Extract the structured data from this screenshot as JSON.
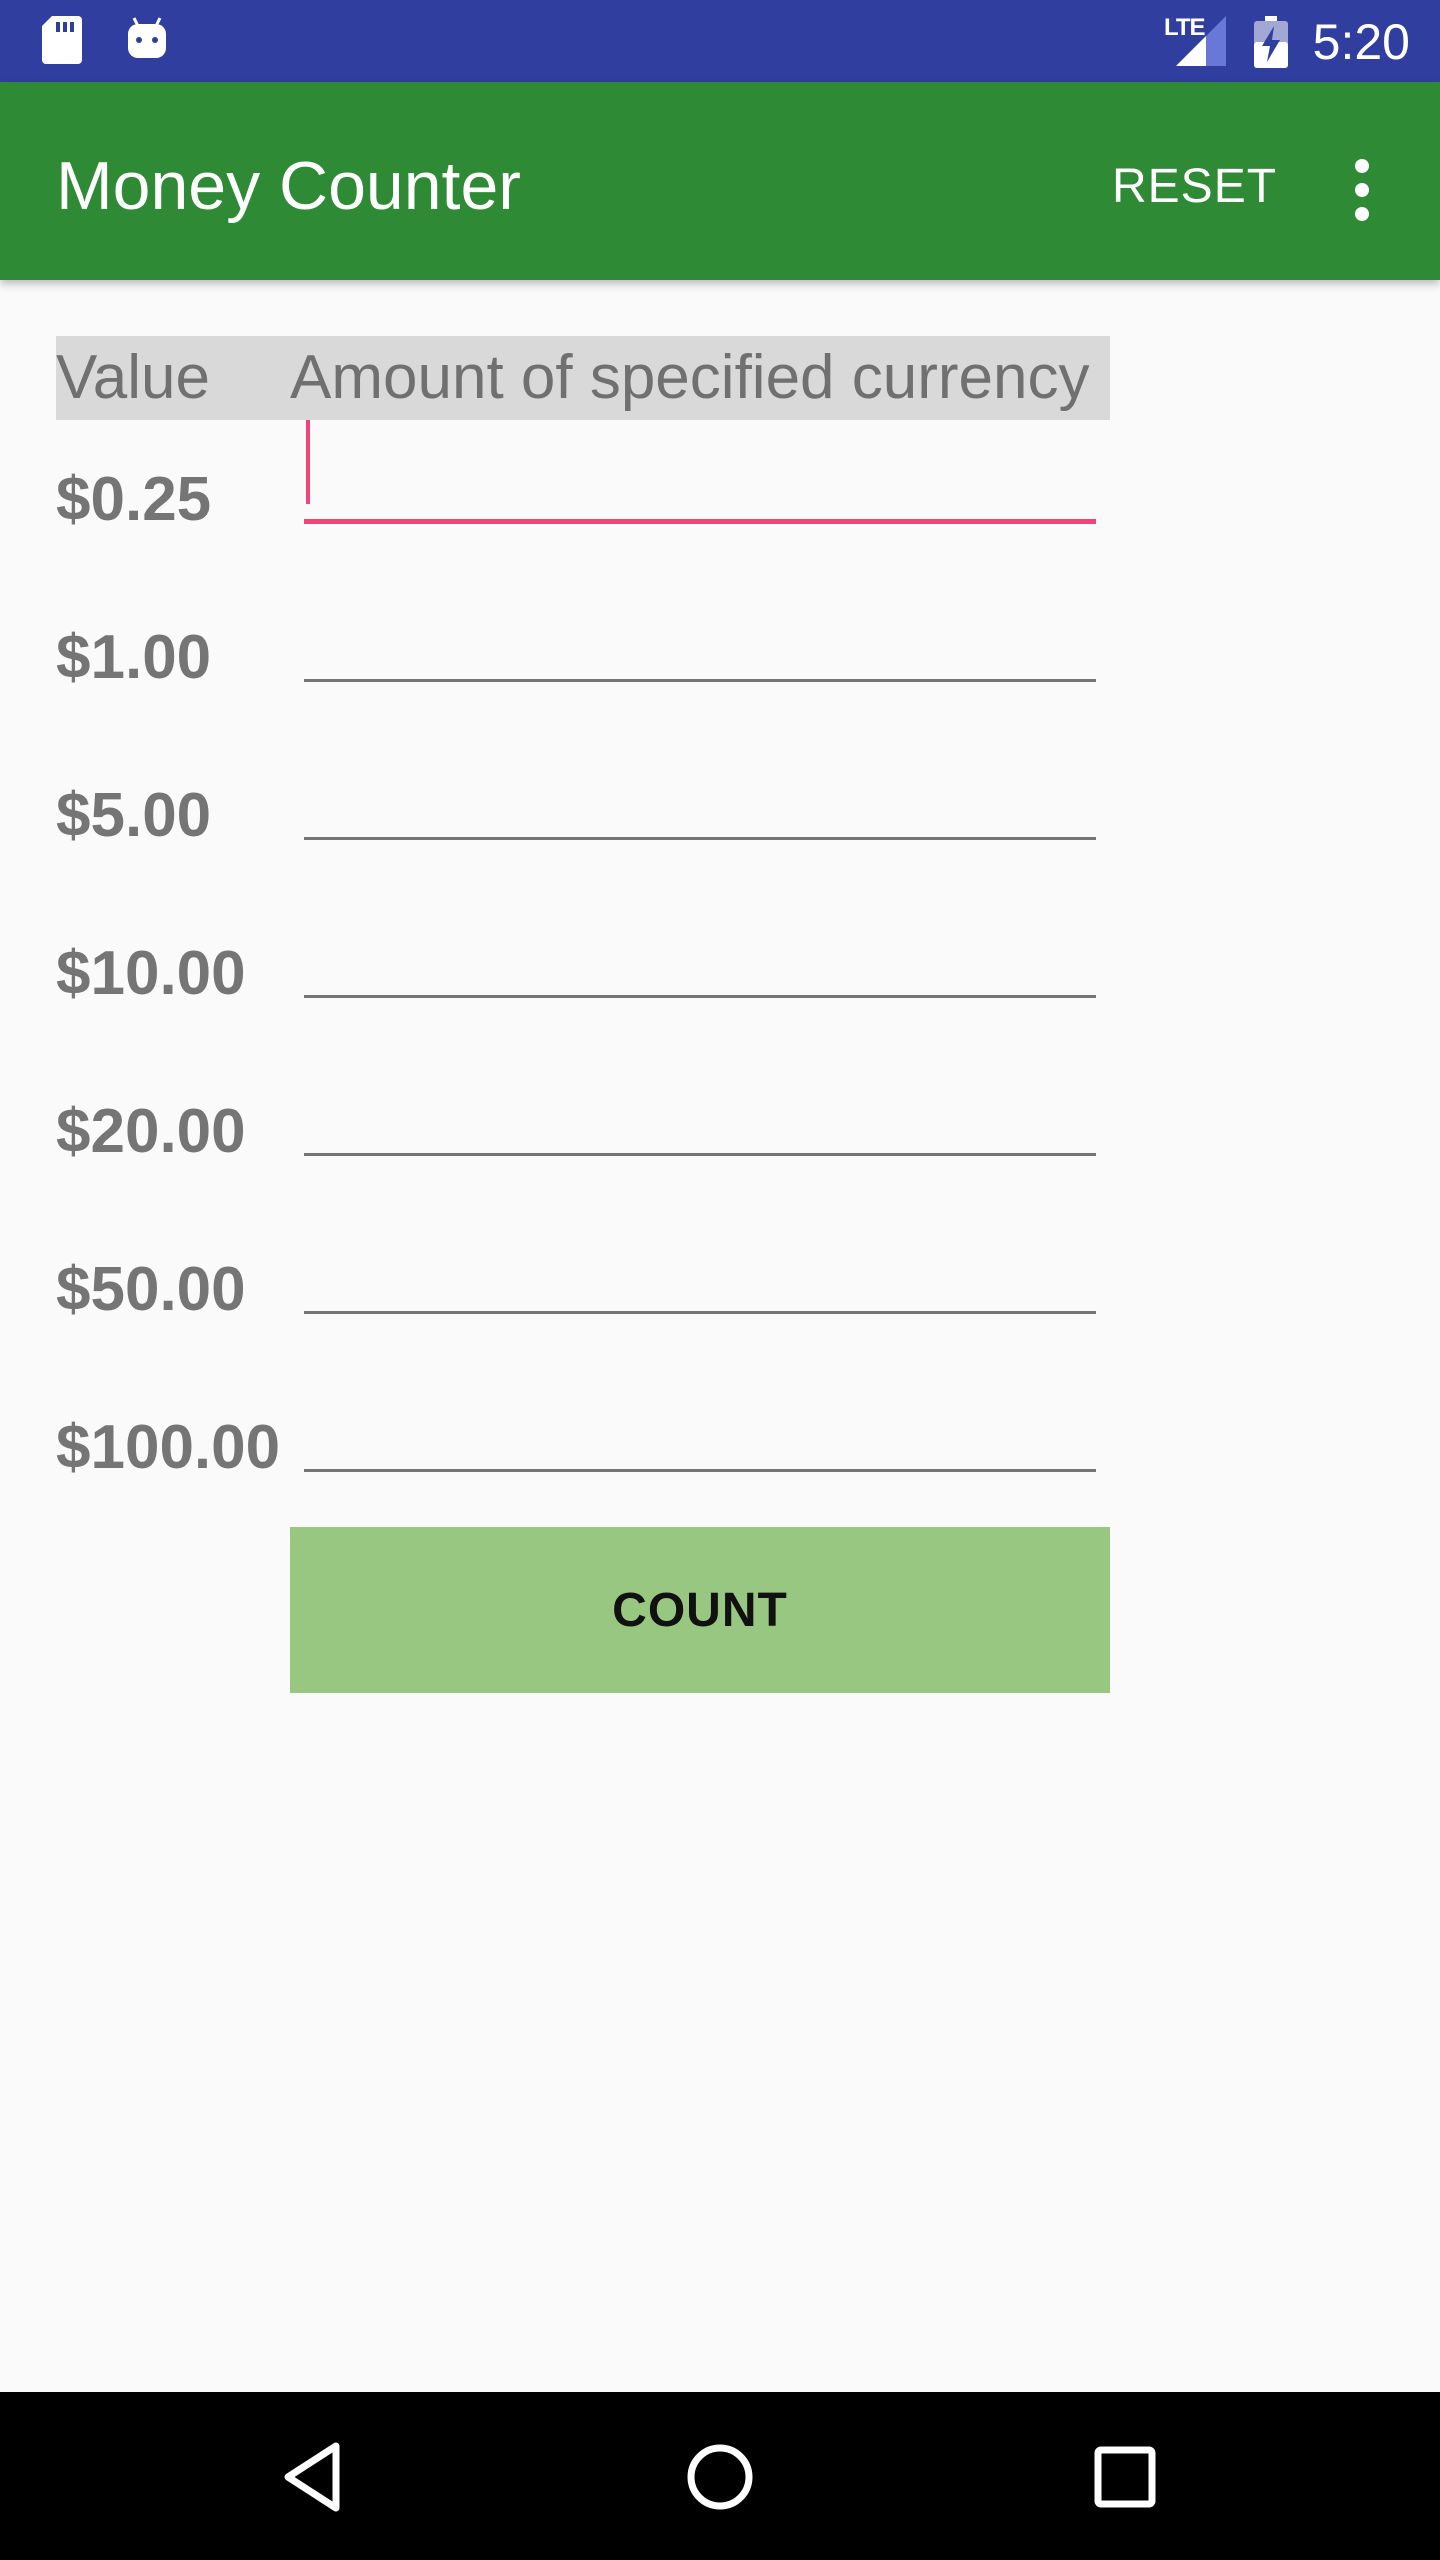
{
  "status_bar": {
    "time": "5:20",
    "network": "LTE",
    "icons": [
      "sd-card-icon",
      "android-icon",
      "signal-icon",
      "battery-charging-icon"
    ]
  },
  "app_bar": {
    "title": "Money Counter",
    "reset_label": "RESET",
    "overflow_icon": "more-vert-icon"
  },
  "table": {
    "header_value": "Value",
    "header_amount": "Amount of specified currency",
    "rows": [
      {
        "label": "$0.25",
        "value": ""
      },
      {
        "label": "$1.00",
        "value": ""
      },
      {
        "label": "$5.00",
        "value": ""
      },
      {
        "label": "$10.00",
        "value": ""
      },
      {
        "label": "$20.00",
        "value": ""
      },
      {
        "label": "$50.00",
        "value": ""
      },
      {
        "label": "$100.00",
        "value": ""
      }
    ]
  },
  "count_button": {
    "label": "COUNT"
  },
  "nav_bar": {
    "icons": [
      "back-icon",
      "home-icon",
      "recents-icon"
    ]
  },
  "colors": {
    "status_bar": "#303f9f",
    "app_bar": "#2e8a35",
    "accent": "#f0447a",
    "count_button": "#98c781"
  }
}
